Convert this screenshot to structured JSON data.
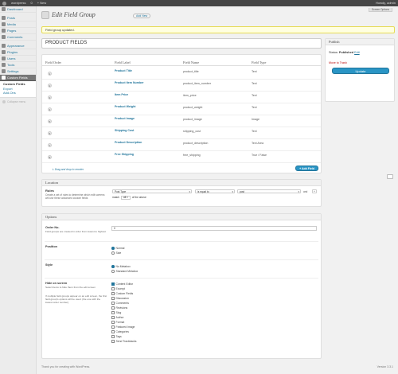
{
  "adminbar": {
    "site_name": "wordpress",
    "counter": "0",
    "new_label": "New",
    "greeting": "Howdy, admin"
  },
  "sidebar": {
    "items": [
      {
        "label": "Dashboard"
      },
      {
        "label": "Posts"
      },
      {
        "label": "Media"
      },
      {
        "label": "Pages"
      },
      {
        "label": "Comments"
      },
      {
        "label": "Appearance"
      },
      {
        "label": "Plugins"
      },
      {
        "label": "Users"
      },
      {
        "label": "Tools"
      },
      {
        "label": "Settings"
      },
      {
        "label": "Custom Fields"
      }
    ],
    "submenu": [
      "Custom Fields",
      "Export",
      "Add-Ons"
    ],
    "collapse": "Collapse menu"
  },
  "header": {
    "title": "Edit Field Group",
    "add_new": "Add New",
    "screen_options": "Screen Options"
  },
  "notice": "Field group updated.",
  "post_title": "PRODUCT FIELDS",
  "fields": {
    "columns": [
      "Field Order",
      "Field Label",
      "Field Name",
      "Field Type"
    ],
    "rows": [
      {
        "order": "1",
        "label": "Product Title",
        "name": "product_title",
        "type": "Text"
      },
      {
        "order": "2",
        "label": "Product Item Number",
        "name": "product_item_number",
        "type": "Text"
      },
      {
        "order": "3",
        "label": "Item Price",
        "name": "item_price",
        "type": "Text"
      },
      {
        "order": "4",
        "label": "Product Weight",
        "name": "product_weight",
        "type": "Text"
      },
      {
        "order": "5",
        "label": "Product Image",
        "name": "product_image",
        "type": "Image"
      },
      {
        "order": "6",
        "label": "Shipping Cost",
        "name": "shipping_cost",
        "type": "Text"
      },
      {
        "order": "7",
        "label": "Product Description",
        "name": "product_description",
        "type": "Text Area"
      },
      {
        "order": "8",
        "label": "Free Shipping",
        "name": "free_shipping",
        "type": "True / False"
      }
    ],
    "drag_hint": "Drag and drop to reorder",
    "add_button": "+ Add Field"
  },
  "location": {
    "title": "Location",
    "rules_label": "Rules",
    "rules_desc": "Create a set of rules to determine which edit screens will use these advanced custom fields",
    "param": "Post Type",
    "operator": "is equal to",
    "value": "post",
    "and": "and",
    "match_prefix": "match",
    "match_value": "all",
    "match_suffix": "of the above"
  },
  "options": {
    "title": "Options",
    "order_label": "Order No.",
    "order_desc": "Field groups are created in order from lowest to highest",
    "order_value": "0",
    "position_label": "Position",
    "position_opts": [
      {
        "label": "Normal",
        "on": true
      },
      {
        "label": "Side",
        "on": false
      }
    ],
    "style_label": "Style",
    "style_opts": [
      {
        "label": "No Metabox",
        "on": true
      },
      {
        "label": "Standard Metabox",
        "on": false
      }
    ],
    "hide_label": "Hide on screen",
    "hide_desc1": "Select items to hide them from the edit screen",
    "hide_desc2": "If multiple field groups appear on an edit screen, the first field group's options will be used. (the one with the lowest order number)",
    "hide_items": [
      {
        "label": "Content Editor",
        "on": true
      },
      {
        "label": "Excerpt",
        "on": false
      },
      {
        "label": "Custom Fields",
        "on": false
      },
      {
        "label": "Discussion",
        "on": false
      },
      {
        "label": "Comments",
        "on": false
      },
      {
        "label": "Revisions",
        "on": false
      },
      {
        "label": "Slug",
        "on": false
      },
      {
        "label": "Author",
        "on": false
      },
      {
        "label": "Format",
        "on": false
      },
      {
        "label": "Featured Image",
        "on": false
      },
      {
        "label": "Categories",
        "on": false
      },
      {
        "label": "Tags",
        "on": false
      },
      {
        "label": "Send Trackbacks",
        "on": false
      }
    ]
  },
  "publish": {
    "title": "Publish",
    "status_label": "Status:",
    "status_value": "Published",
    "edit": "Edit",
    "trash": "Move to Trash",
    "update": "Update"
  },
  "footer": {
    "left": "Thank you for creating with WordPress.",
    "right": "Version 3.3.1"
  }
}
